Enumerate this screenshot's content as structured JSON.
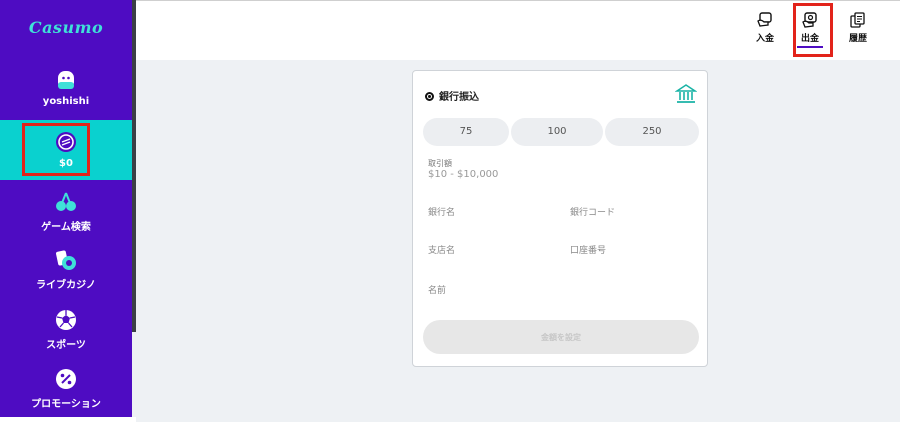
{
  "sidebar": {
    "logo": "Casumo",
    "user_name": "yoshishi",
    "balance": "$0",
    "items": [
      {
        "label": "ゲーム検索",
        "icon": "cherries-icon"
      },
      {
        "label": "ライブカジノ",
        "icon": "cards-chip-icon"
      },
      {
        "label": "スポーツ",
        "icon": "soccer-ball-icon"
      },
      {
        "label": "プロモーション",
        "icon": "percent-badge-icon"
      }
    ]
  },
  "header": {
    "tabs": [
      {
        "label": "入金",
        "icon": "deposit-icon"
      },
      {
        "label": "出金",
        "icon": "withdraw-icon",
        "active": true
      },
      {
        "label": "履歴",
        "icon": "history-icon"
      }
    ]
  },
  "form": {
    "method": "銀行振込",
    "amounts": [
      "75",
      "100",
      "250"
    ],
    "amount_label": "取引額",
    "amount_range": "$10 - $10,000",
    "fields": {
      "bank_name": "銀行名",
      "bank_code": "銀行コード",
      "branch_name": "支店名",
      "account_number": "口座番号",
      "name": "名前"
    },
    "submit_label": "金額を設定"
  },
  "colors": {
    "sidebar_bg": "#4e0cc2",
    "active_item_bg": "#0ad1cf",
    "logo": "#3fe0d8",
    "highlight": "#e2231a",
    "bank_icon": "#19b3a6"
  }
}
